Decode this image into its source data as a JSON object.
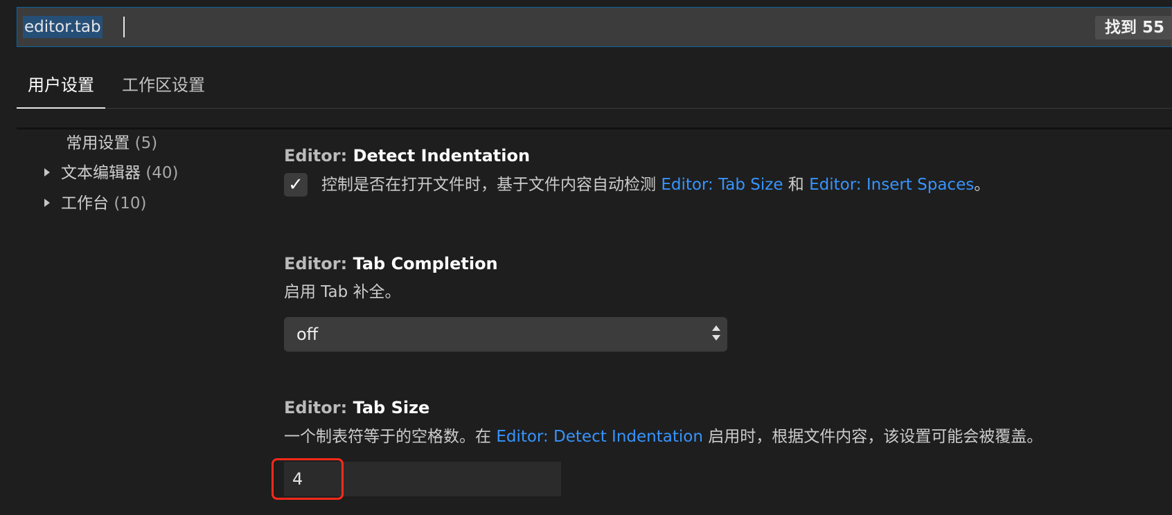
{
  "search": {
    "value": "editor.tab",
    "result_count": "找到 55"
  },
  "tabs": [
    {
      "label": "用户设置",
      "active": true
    },
    {
      "label": "工作区设置",
      "active": false
    }
  ],
  "sidebar": {
    "items": [
      {
        "label": "常用设置",
        "count": "(5)",
        "expandable": false
      },
      {
        "label": "文本编辑器",
        "count": "(40)",
        "expandable": true
      },
      {
        "label": "工作台",
        "count": "(10)",
        "expandable": true
      }
    ]
  },
  "settings": {
    "detect_indentation": {
      "category": "Editor: ",
      "name": "Detect Indentation",
      "checked": true,
      "desc_prefix": "控制是否在打开文件时，基于文件内容自动检测 ",
      "link1": "Editor: Tab Size",
      "desc_mid": " 和 ",
      "link2": "Editor: Insert Spaces",
      "desc_suffix": "。"
    },
    "tab_completion": {
      "category": "Editor: ",
      "name": "Tab Completion",
      "desc": "启用 Tab 补全。",
      "value": "off"
    },
    "tab_size": {
      "category": "Editor: ",
      "name": "Tab Size",
      "desc_prefix": "一个制表符等于的空格数。在 ",
      "link": "Editor: Detect Indentation",
      "desc_suffix": " 启用时，根据文件内容，该设置可能会被覆盖。",
      "value": "4"
    }
  },
  "colors": {
    "accent_link": "#3794ff",
    "highlight": "#ff2a1a",
    "background": "#1e1e1e"
  }
}
